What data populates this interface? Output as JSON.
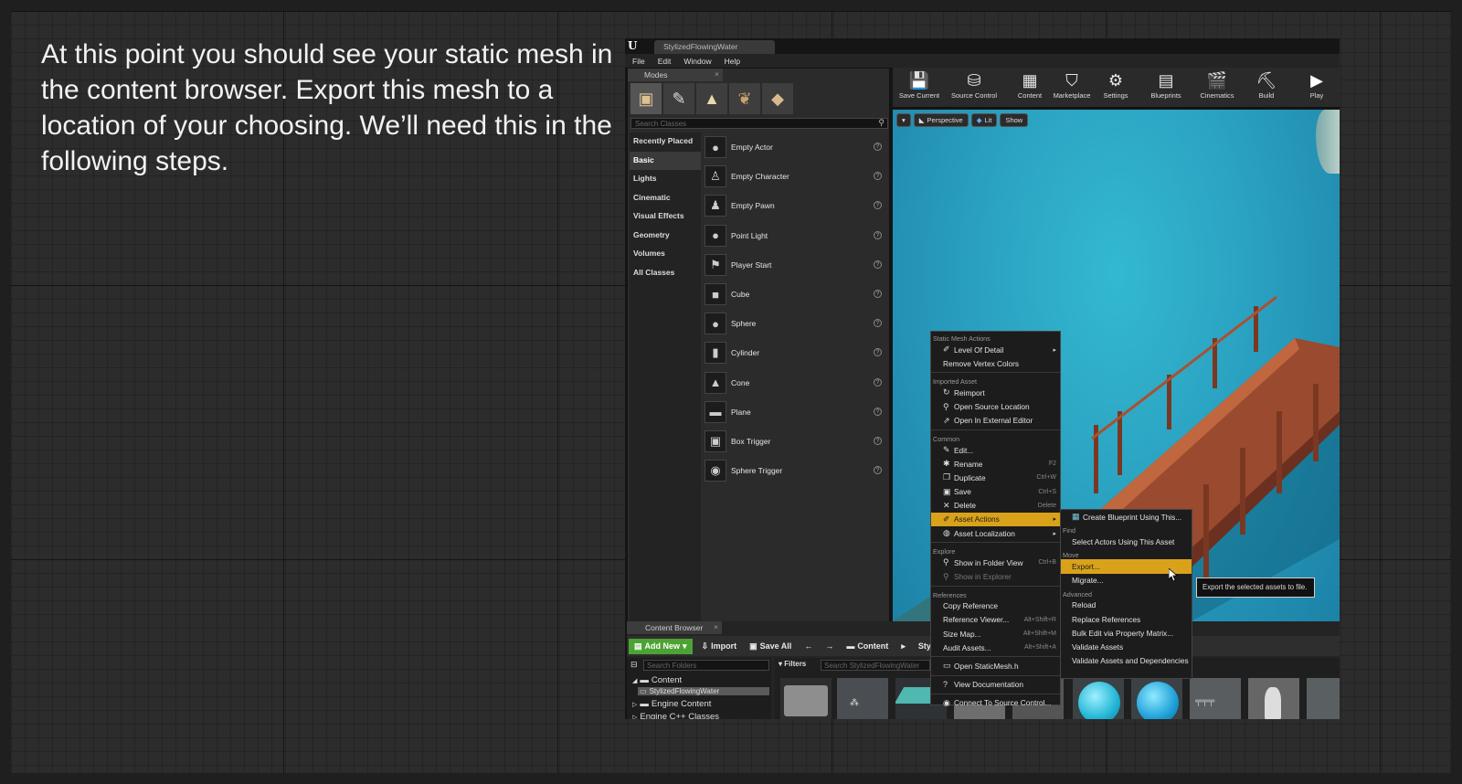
{
  "caption": "At this point you should see your static mesh in the content browser. Export this mesh to a location of your choosing. We’ll need this in the following steps.",
  "editor": {
    "logo": "U",
    "project_tab": "StylizedFlowingWater",
    "menu": [
      "File",
      "Edit",
      "Window",
      "Help"
    ]
  },
  "modes": {
    "tab_label": "Modes",
    "close_label": "×",
    "icons": [
      "place-mode-icon",
      "paint-mode-icon",
      "landscape-mode-icon",
      "foliage-mode-icon",
      "geometry-mode-icon"
    ],
    "search_placeholder": "Search Classes",
    "categories": [
      "Recently Placed",
      "Basic",
      "Lights",
      "Cinematic",
      "Visual Effects",
      "Geometry",
      "Volumes",
      "All Classes"
    ],
    "selected_category": "Basic",
    "items": [
      "Empty Actor",
      "Empty Character",
      "Empty Pawn",
      "Point Light",
      "Player Start",
      "Cube",
      "Sphere",
      "Cylinder",
      "Cone",
      "Plane",
      "Box Trigger",
      "Sphere Trigger"
    ],
    "help_label": "?"
  },
  "toolbar": {
    "buttons": [
      "Save Current",
      "Source Control",
      "Content",
      "Marketplace",
      "Settings",
      "Blueprints",
      "Cinematics",
      "Build",
      "Play"
    ]
  },
  "viewport": {
    "perspective": "Perspective",
    "lit": "Lit",
    "show": "Show"
  },
  "content_browser": {
    "tab_label": "Content Browser",
    "close_label": "×",
    "add_new": "Add New",
    "import": "Import",
    "save_all": "Save All",
    "path_content": "Content",
    "path_next": "Sty",
    "search_folders_placeholder": "Search Folders",
    "tree": [
      "Content",
      "StylizedFlowingWater",
      "Engine Content",
      "Engine C++ Classes"
    ],
    "filters": "Filters",
    "search_assets_placeholder": "Search StylizedFlowingWater"
  },
  "context_menu": {
    "sections": {
      "static_mesh": "Static Mesh Actions",
      "imported": "Imported Asset",
      "common": "Common",
      "explore": "Explore",
      "references": "References"
    },
    "level_of_detail": "Level Of Detail",
    "remove_vertex_colors": "Remove Vertex Colors",
    "reimport": "Reimport",
    "open_source_location": "Open Source Location",
    "open_external_editor": "Open In External Editor",
    "edit": "Edit...",
    "rename": "Rename",
    "rename_sc": "F2",
    "duplicate": "Duplicate",
    "duplicate_sc": "Ctrl+W",
    "save": "Save",
    "save_sc": "Ctrl+S",
    "delete": "Delete",
    "delete_sc": "Delete",
    "asset_actions": "Asset Actions",
    "asset_localization": "Asset Localization",
    "show_in_folder_view": "Show in Folder View",
    "show_in_folder_view_sc": "Ctrl+B",
    "show_in_explorer": "Show in Explorer",
    "copy_reference": "Copy Reference",
    "reference_viewer": "Reference Viewer...",
    "reference_viewer_sc": "Alt+Shift+R",
    "size_map": "Size Map...",
    "size_map_sc": "Alt+Shift+M",
    "audit_assets": "Audit Assets...",
    "audit_assets_sc": "Alt+Shift+A",
    "open_staticmesh": "Open StaticMesh.h",
    "view_documentation": "View Documentation",
    "connect_source_control": "Connect To Source Control..."
  },
  "submenu": {
    "create_blueprint": "Create Blueprint Using This...",
    "sec_find": "Find",
    "select_actors": "Select Actors Using This Asset",
    "sec_move": "Move",
    "export": "Export...",
    "migrate": "Migrate...",
    "sec_advanced": "Advanced",
    "reload": "Reload",
    "replace_references": "Replace References",
    "bulk_edit": "Bulk Edit via Property Matrix...",
    "validate_assets": "Validate Assets",
    "validate_deps": "Validate Assets and Dependencies"
  },
  "tooltip": "Export the selected assets to file.",
  "colors": {
    "highlight": "#d9a21a",
    "add_new": "#4ca334",
    "water": "#2aa0c0"
  }
}
